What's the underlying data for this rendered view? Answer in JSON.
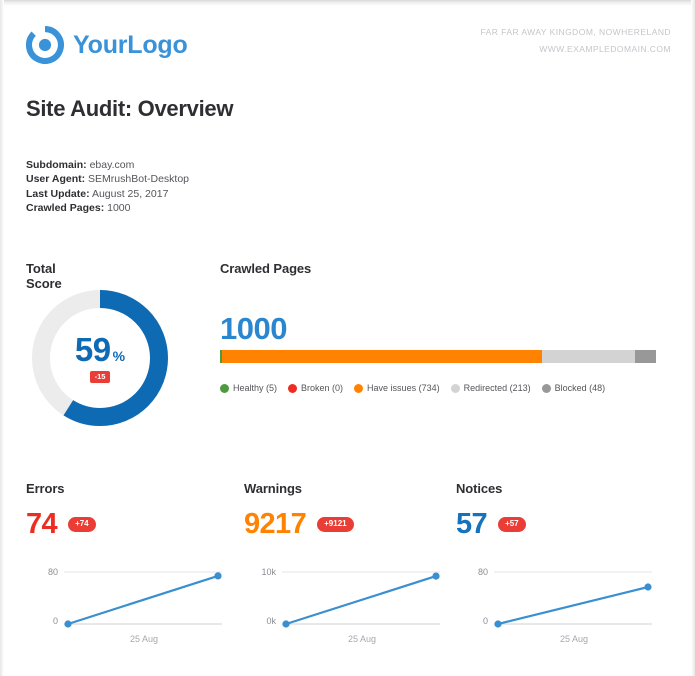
{
  "header": {
    "logo_text": "YourLogo",
    "logo_icon": "circular-ring-logo-icon",
    "address_line": "FAR FAR AWAY KINGDOM, NOWHERELAND",
    "website_line": "WWW.EXAMPLEDOMAIN.COM"
  },
  "page_title": "Site Audit: Overview",
  "meta": [
    {
      "key": "Subdomain:",
      "value": "ebay.com"
    },
    {
      "key": "User Agent:",
      "value": "SEMrushBot-Desktop"
    },
    {
      "key": "Last Update:",
      "value": "August 25, 2017"
    },
    {
      "key": "Crawled Pages:",
      "value": "1000"
    }
  ],
  "total_score": {
    "title": "Total Score",
    "value": "59",
    "unit": "%",
    "delta": "-15"
  },
  "crawled_pages": {
    "title": "Crawled Pages",
    "total": "1000",
    "legend": [
      {
        "label": "Healthy (5)",
        "name": "healthy",
        "color": "#4e9a3e",
        "value": 5
      },
      {
        "label": "Broken (0)",
        "name": "broken",
        "color": "#ee2c21",
        "value": 0
      },
      {
        "label": "Have issues (734)",
        "name": "have-issues",
        "color": "#ff8300",
        "value": 734
      },
      {
        "label": "Redirected (213)",
        "name": "redirected",
        "color": "#d3d3d3",
        "value": 213
      },
      {
        "label": "Blocked (48)",
        "name": "blocked",
        "color": "#989898",
        "value": 48
      }
    ]
  },
  "metrics": [
    {
      "name": "errors",
      "title": "Errors",
      "value": "74",
      "badge": "+74",
      "value_color": "#ea2f22",
      "y_top": "80",
      "y_bottom": "0",
      "x_label": "25 Aug"
    },
    {
      "name": "warnings",
      "title": "Warnings",
      "value": "9217",
      "badge": "+9121",
      "value_color": "#ff8300",
      "y_top": "10k",
      "y_bottom": "0k",
      "x_label": "25 Aug"
    },
    {
      "name": "notices",
      "title": "Notices",
      "value": "57",
      "badge": "+57",
      "value_color": "#1573bd",
      "y_top": "80",
      "y_bottom": "0",
      "x_label": "25 Aug"
    }
  ],
  "chart_data": [
    {
      "type": "pie",
      "name": "total-score-donut",
      "title": "Total Score",
      "labels": [
        "Score",
        "Remaining"
      ],
      "values": [
        59,
        41
      ],
      "colors": [
        "#0f6ab4",
        "#ececec"
      ],
      "center_label": "59%",
      "delta": -15,
      "start_angle_deg": 0,
      "direction": "clockwise"
    },
    {
      "type": "bar",
      "name": "crawled-pages-stacked-bar",
      "title": "Crawled Pages",
      "orientation": "horizontal",
      "stacked": true,
      "total": 1000,
      "categories": [
        "Healthy",
        "Broken",
        "Have issues",
        "Redirected",
        "Blocked"
      ],
      "values": [
        5,
        0,
        734,
        213,
        48
      ],
      "colors": [
        "#4e9a3e",
        "#ee2c21",
        "#ff8300",
        "#d3d3d3",
        "#989898"
      ],
      "legend_position": "bottom",
      "grid": false
    },
    {
      "type": "line",
      "name": "errors-sparkline",
      "title": "Errors",
      "x": [
        "",
        "25 Aug"
      ],
      "values": [
        0,
        74
      ],
      "ylim": [
        0,
        80
      ],
      "yticks": [
        0,
        80
      ],
      "ytick_labels": [
        "0",
        "80"
      ],
      "xlabel": "25 Aug",
      "ylabel": "",
      "color": "#3a8fd0",
      "grid": true
    },
    {
      "type": "line",
      "name": "warnings-sparkline",
      "title": "Warnings",
      "x": [
        "",
        "25 Aug"
      ],
      "values": [
        0,
        9217
      ],
      "ylim": [
        0,
        10000
      ],
      "yticks": [
        0,
        10000
      ],
      "ytick_labels": [
        "0k",
        "10k"
      ],
      "xlabel": "25 Aug",
      "ylabel": "",
      "color": "#3a8fd0",
      "grid": true
    },
    {
      "type": "line",
      "name": "notices-sparkline",
      "title": "Notices",
      "x": [
        "",
        "25 Aug"
      ],
      "values": [
        0,
        57
      ],
      "ylim": [
        0,
        80
      ],
      "yticks": [
        0,
        80
      ],
      "ytick_labels": [
        "0",
        "80"
      ],
      "xlabel": "25 Aug",
      "ylabel": "",
      "color": "#3a8fd0",
      "grid": true
    }
  ]
}
